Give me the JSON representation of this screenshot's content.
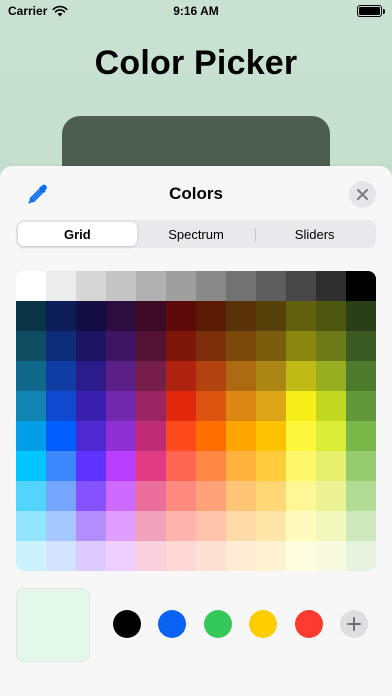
{
  "status_bar": {
    "carrier": "Carrier",
    "time": "9:16 AM"
  },
  "page": {
    "title": "Color Picker"
  },
  "sheet": {
    "title": "Colors",
    "tabs": [
      {
        "label": "Grid",
        "selected": true
      },
      {
        "label": "Spectrum",
        "selected": false
      },
      {
        "label": "Sliders",
        "selected": false
      }
    ],
    "grid_colors": [
      [
        "#ffffff",
        "#ececec",
        "#d6d6d6",
        "#c4c4c4",
        "#b1b1b1",
        "#9e9e9e",
        "#898989",
        "#737373",
        "#5e5e5e",
        "#474747",
        "#2f2f2f",
        "#000000"
      ],
      [
        "#0b3446",
        "#0c1e57",
        "#150e43",
        "#2c0d3e",
        "#3b0c24",
        "#5c0a0a",
        "#5a1b06",
        "#583208",
        "#56410a",
        "#625f0d",
        "#4d5710",
        "#2a3e17"
      ],
      [
        "#0f4d63",
        "#0d2d78",
        "#1f1462",
        "#3e1560",
        "#541334",
        "#7d1709",
        "#7d2f0a",
        "#7b4a0b",
        "#7a5e0e",
        "#8b860f",
        "#6c7b17",
        "#3b5a22"
      ],
      [
        "#10688a",
        "#0f3da3",
        "#2c1b8a",
        "#5a2087",
        "#761e4a",
        "#ad230f",
        "#b0430f",
        "#ad6a12",
        "#ac8614",
        "#c0ba16",
        "#98ae21",
        "#4e7a2c"
      ],
      [
        "#1184b2",
        "#1049cf",
        "#391fae",
        "#7128ad",
        "#9a2562",
        "#e0290d",
        "#dd5410",
        "#dc8614",
        "#dba515",
        "#f6ef1a",
        "#c1d823",
        "#62983a"
      ],
      [
        "#009ee6",
        "#005dff",
        "#4c29d1",
        "#8f30d4",
        "#bf2d77",
        "#ff4a1c",
        "#ff6f00",
        "#ffa500",
        "#ffc200",
        "#fdf73c",
        "#d9ec37",
        "#77b849"
      ],
      [
        "#00c5ff",
        "#3d87ff",
        "#5f33ff",
        "#b83dff",
        "#e13b83",
        "#ff6552",
        "#ff8846",
        "#ffb23d",
        "#ffcc3b",
        "#fef76a",
        "#e6f06c",
        "#96cc6e"
      ],
      [
        "#52d4ff",
        "#74a6ff",
        "#8452ff",
        "#cf6aff",
        "#ea6f9b",
        "#ff8b80",
        "#ffa27a",
        "#ffc577",
        "#ffd875",
        "#fff796",
        "#ebf394",
        "#b2db96"
      ],
      [
        "#93e4ff",
        "#a6c6ff",
        "#b38eff",
        "#e09cff",
        "#f1a1bc",
        "#ffb4ad",
        "#ffc3aa",
        "#ffd9a8",
        "#ffe5a7",
        "#fffbbd",
        "#f2f7bc",
        "#cfe8bd"
      ],
      [
        "#cdf2ff",
        "#d3e3ff",
        "#dccbff",
        "#efcfff",
        "#f8d0de",
        "#ffd8d5",
        "#ffe1d4",
        "#ffecd4",
        "#fff2d3",
        "#fffde0",
        "#f8fbdf",
        "#e6f3de"
      ]
    ],
    "current_color": "#e3f7ea",
    "saved_swatches": [
      "#000000",
      "#0a62f5",
      "#34c759",
      "#ffcc00",
      "#ff3b30"
    ]
  }
}
